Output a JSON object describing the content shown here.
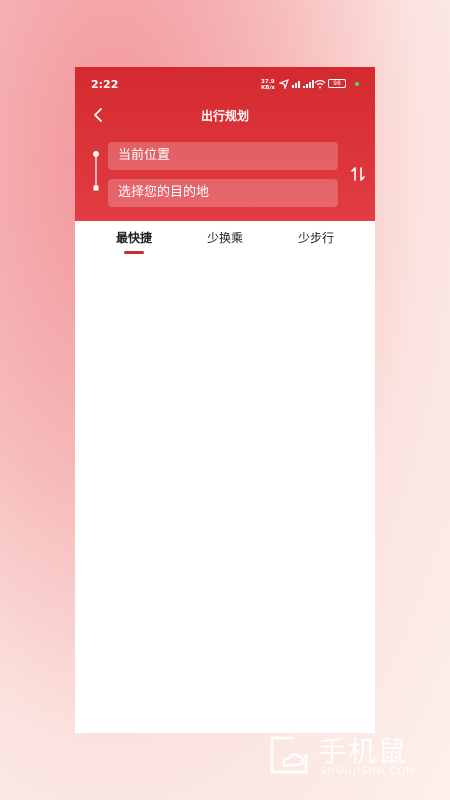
{
  "status_bar": {
    "time": "2:22",
    "net_speed_value": "37.9",
    "net_speed_unit": "KB/s",
    "battery": "98",
    "icons": [
      "location-arrow-icon",
      "hd-signal-icon",
      "signal-bars-icon",
      "wifi-icon",
      "battery-icon"
    ]
  },
  "nav": {
    "title": "出行规划",
    "back_icon": "chevron-left-icon"
  },
  "route": {
    "origin_value": "当前位置",
    "destination_placeholder": "选择您的目的地",
    "swap_icon": "swap-vertical-icon"
  },
  "tabs": [
    {
      "label": "最快捷",
      "active": true
    },
    {
      "label": "少换乘",
      "active": false
    },
    {
      "label": "少步行",
      "active": false
    }
  ],
  "watermark": {
    "brand": "手机鼠",
    "domain": "SHOUJISHU.COM"
  },
  "colors": {
    "header_red": "#d42a2f",
    "indicator": "#d42a2f"
  }
}
